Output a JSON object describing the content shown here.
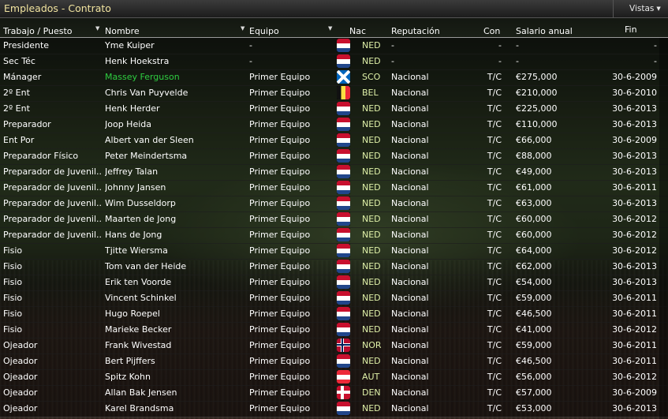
{
  "window": {
    "title": "Empleados - Contrato",
    "views_label": "Vistas",
    "views_arrow": "▼"
  },
  "columns": {
    "trabajo": "Trabajo / Puesto",
    "nombre": "Nombre",
    "equipo": "Equipo",
    "nac": "Nac",
    "reputacion": "Reputación",
    "con": "Con",
    "salario": "Salario anual",
    "fin": "Fin",
    "sort_arrow": "▼"
  },
  "colors": {
    "highlight_name": "#2ecc40",
    "nat_text": "#dff0a8",
    "title_text": "#f2e4a0"
  },
  "flags": {
    "NED": [
      "#c8102e",
      "#ffffff",
      "#21468b"
    ],
    "AUT": [
      "#ed2939",
      "#ffffff",
      "#ed2939"
    ]
  },
  "rows": [
    {
      "trabajo": "Presidente",
      "nombre": "Yme Kuiper",
      "equipo": "-",
      "flag": "NED",
      "nac": "NED",
      "reputacion": "-",
      "con": "-",
      "salario": "-",
      "fin": "-"
    },
    {
      "trabajo": "Sec Téc",
      "nombre": "Henk Hoekstra",
      "equipo": "-",
      "flag": "NED",
      "nac": "NED",
      "reputacion": "-",
      "con": "-",
      "salario": "-",
      "fin": "-"
    },
    {
      "trabajo": "Mánager",
      "nombre": "Massey Ferguson",
      "equipo": "Primer Equipo",
      "flag": "SCO",
      "nac": "SCO",
      "reputacion": "Nacional",
      "con": "T/C",
      "salario": "€275,000",
      "fin": "30-6-2009",
      "highlight": true
    },
    {
      "trabajo": "2º Ent",
      "nombre": "Chris Van Puyvelde",
      "equipo": "Primer Equipo",
      "flag": "BEL",
      "nac": "BEL",
      "reputacion": "Nacional",
      "con": "T/C",
      "salario": "€210,000",
      "fin": "30-6-2010"
    },
    {
      "trabajo": "2º Ent",
      "nombre": "Henk Herder",
      "equipo": "Primer Equipo",
      "flag": "NED",
      "nac": "NED",
      "reputacion": "Nacional",
      "con": "T/C",
      "salario": "€225,000",
      "fin": "30-6-2013"
    },
    {
      "trabajo": "Preparador",
      "nombre": "Joop Heida",
      "equipo": "Primer Equipo",
      "flag": "NED",
      "nac": "NED",
      "reputacion": "Nacional",
      "con": "T/C",
      "salario": "€110,000",
      "fin": "30-6-2013"
    },
    {
      "trabajo": "Ent Por",
      "nombre": "Albert van der Sleen",
      "equipo": "Primer Equipo",
      "flag": "NED",
      "nac": "NED",
      "reputacion": "Nacional",
      "con": "T/C",
      "salario": "€66,000",
      "fin": "30-6-2009"
    },
    {
      "trabajo": "Preparador Físico",
      "nombre": "Peter Meindertsma",
      "equipo": "Primer Equipo",
      "flag": "NED",
      "nac": "NED",
      "reputacion": "Nacional",
      "con": "T/C",
      "salario": "€88,000",
      "fin": "30-6-2013"
    },
    {
      "trabajo": "Preparador de Juvenil...",
      "nombre": "Jeffrey Talan",
      "equipo": "Primer Equipo",
      "flag": "NED",
      "nac": "NED",
      "reputacion": "Nacional",
      "con": "T/C",
      "salario": "€49,000",
      "fin": "30-6-2013"
    },
    {
      "trabajo": "Preparador de Juvenil...",
      "nombre": "Johnny Jansen",
      "equipo": "Primer Equipo",
      "flag": "NED",
      "nac": "NED",
      "reputacion": "Nacional",
      "con": "T/C",
      "salario": "€61,000",
      "fin": "30-6-2011"
    },
    {
      "trabajo": "Preparador de Juvenil...",
      "nombre": "Wim Dusseldorp",
      "equipo": "Primer Equipo",
      "flag": "NED",
      "nac": "NED",
      "reputacion": "Nacional",
      "con": "T/C",
      "salario": "€63,000",
      "fin": "30-6-2013"
    },
    {
      "trabajo": "Preparador de Juvenil...",
      "nombre": "Maarten de Jong",
      "equipo": "Primer Equipo",
      "flag": "NED",
      "nac": "NED",
      "reputacion": "Nacional",
      "con": "T/C",
      "salario": "€60,000",
      "fin": "30-6-2012"
    },
    {
      "trabajo": "Preparador de Juvenil...",
      "nombre": "Hans de Jong",
      "equipo": "Primer Equipo",
      "flag": "NED",
      "nac": "NED",
      "reputacion": "Nacional",
      "con": "T/C",
      "salario": "€60,000",
      "fin": "30-6-2012"
    },
    {
      "trabajo": "Fisio",
      "nombre": "Tjitte Wiersma",
      "equipo": "Primer Equipo",
      "flag": "NED",
      "nac": "NED",
      "reputacion": "Nacional",
      "con": "T/C",
      "salario": "€64,000",
      "fin": "30-6-2012"
    },
    {
      "trabajo": "Fisio",
      "nombre": "Tom van der Heide",
      "equipo": "Primer Equipo",
      "flag": "NED",
      "nac": "NED",
      "reputacion": "Nacional",
      "con": "T/C",
      "salario": "€62,000",
      "fin": "30-6-2013"
    },
    {
      "trabajo": "Fisio",
      "nombre": "Erik ten Voorde",
      "equipo": "Primer Equipo",
      "flag": "NED",
      "nac": "NED",
      "reputacion": "Nacional",
      "con": "T/C",
      "salario": "€54,000",
      "fin": "30-6-2013"
    },
    {
      "trabajo": "Fisio",
      "nombre": "Vincent Schinkel",
      "equipo": "Primer Equipo",
      "flag": "NED",
      "nac": "NED",
      "reputacion": "Nacional",
      "con": "T/C",
      "salario": "€59,000",
      "fin": "30-6-2011"
    },
    {
      "trabajo": "Fisio",
      "nombre": "Hugo Roepel",
      "equipo": "Primer Equipo",
      "flag": "NED",
      "nac": "NED",
      "reputacion": "Nacional",
      "con": "T/C",
      "salario": "€46,500",
      "fin": "30-6-2011"
    },
    {
      "trabajo": "Fisio",
      "nombre": "Marieke Becker",
      "equipo": "Primer Equipo",
      "flag": "NED",
      "nac": "NED",
      "reputacion": "Nacional",
      "con": "T/C",
      "salario": "€41,000",
      "fin": "30-6-2012"
    },
    {
      "trabajo": "Ojeador",
      "nombre": "Frank Wivestad",
      "equipo": "Primer Equipo",
      "flag": "NOR",
      "nac": "NOR",
      "reputacion": "Nacional",
      "con": "T/C",
      "salario": "€59,000",
      "fin": "30-6-2011"
    },
    {
      "trabajo": "Ojeador",
      "nombre": "Bert Pijffers",
      "equipo": "Primer Equipo",
      "flag": "NED",
      "nac": "NED",
      "reputacion": "Nacional",
      "con": "T/C",
      "salario": "€46,500",
      "fin": "30-6-2011"
    },
    {
      "trabajo": "Ojeador",
      "nombre": "Spitz Kohn",
      "equipo": "Primer Equipo",
      "flag": "AUT",
      "nac": "AUT",
      "reputacion": "Nacional",
      "con": "T/C",
      "salario": "€56,000",
      "fin": "30-6-2012"
    },
    {
      "trabajo": "Ojeador",
      "nombre": "Allan Bak Jensen",
      "equipo": "Primer Equipo",
      "flag": "DEN",
      "nac": "DEN",
      "reputacion": "Nacional",
      "con": "T/C",
      "salario": "€57,000",
      "fin": "30-6-2009"
    },
    {
      "trabajo": "Ojeador",
      "nombre": "Karel Brandsma",
      "equipo": "Primer Equipo",
      "flag": "NED",
      "nac": "NED",
      "reputacion": "Nacional",
      "con": "T/C",
      "salario": "€53,000",
      "fin": "30-6-2013"
    }
  ]
}
